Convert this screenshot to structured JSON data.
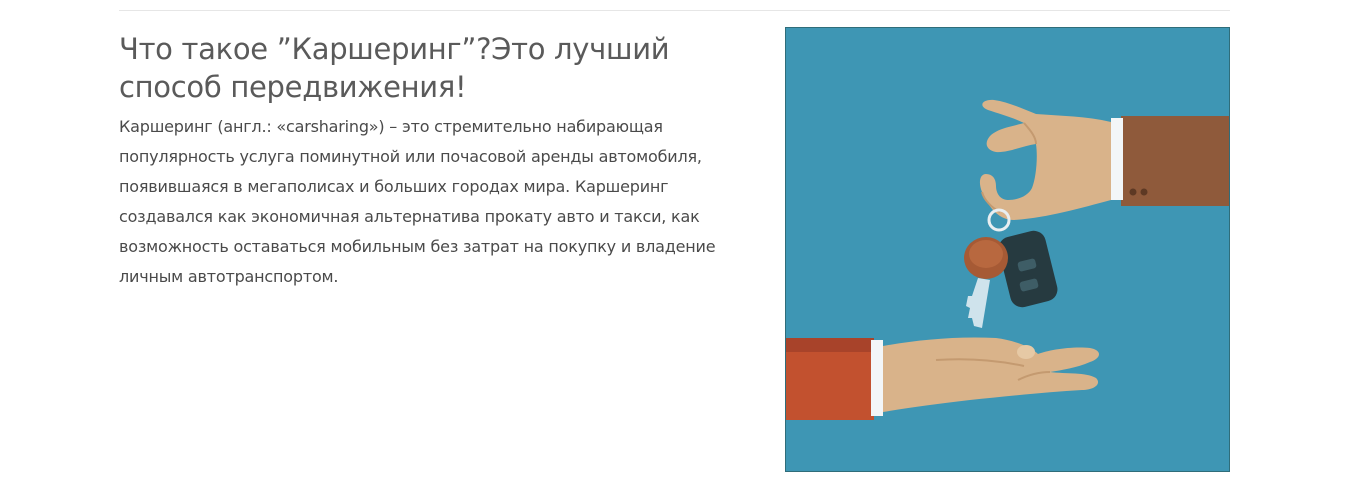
{
  "article": {
    "title": "Что такое ”Каршеринг”?Это лучший способ передвижения!",
    "body": "Каршеринг (англ.: «carsharing») – это стремительно набирающая популярность услуга поминутной или почасовой аренды автомобиля, появившаяся в мегаполисах и больших городах мира. Каршеринг создавался как экономичная альтернатива прокату авто и такси, как возможность оставаться мобильным без затрат на покупку и владение личным автотранспортом."
  },
  "illustration": {
    "depicts": "hand-passing-car-keys-to-open-hand",
    "colors": {
      "background": "#3e96b4",
      "skin": "#d9b38a",
      "upper_sleeve": "#8f5a3b",
      "lower_sleeve": "#c2512f",
      "cuff": "#f3f6f8",
      "key_fob": "#263a40",
      "key_head": "#a65a35",
      "key_blade": "#cfe3ec"
    }
  }
}
